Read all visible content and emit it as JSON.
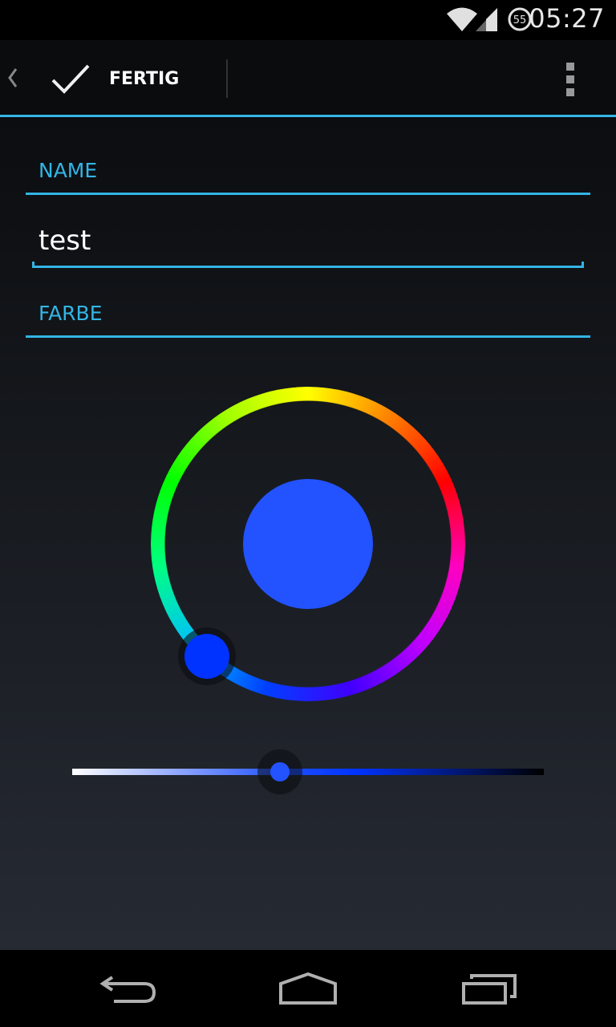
{
  "status_bar": {
    "time": "05:27",
    "notification_count": "55",
    "icons": [
      "wifi-icon",
      "signal-icon",
      "alarm-icon"
    ]
  },
  "action_bar": {
    "done_label": "FERTIG",
    "icons": [
      "up-caret-icon",
      "check-icon",
      "overflow-menu-icon"
    ]
  },
  "form": {
    "name_label": "NAME",
    "name_value": "test",
    "color_label": "FARBE"
  },
  "color_picker": {
    "selected_color": "#2352ff",
    "hue_color": "#0033ff",
    "value_level": 0.44
  },
  "colors": {
    "accent": "#33b5e5",
    "background": "#000000"
  },
  "nav_bar": {
    "icons": [
      "back-icon",
      "home-icon",
      "recents-icon"
    ]
  }
}
